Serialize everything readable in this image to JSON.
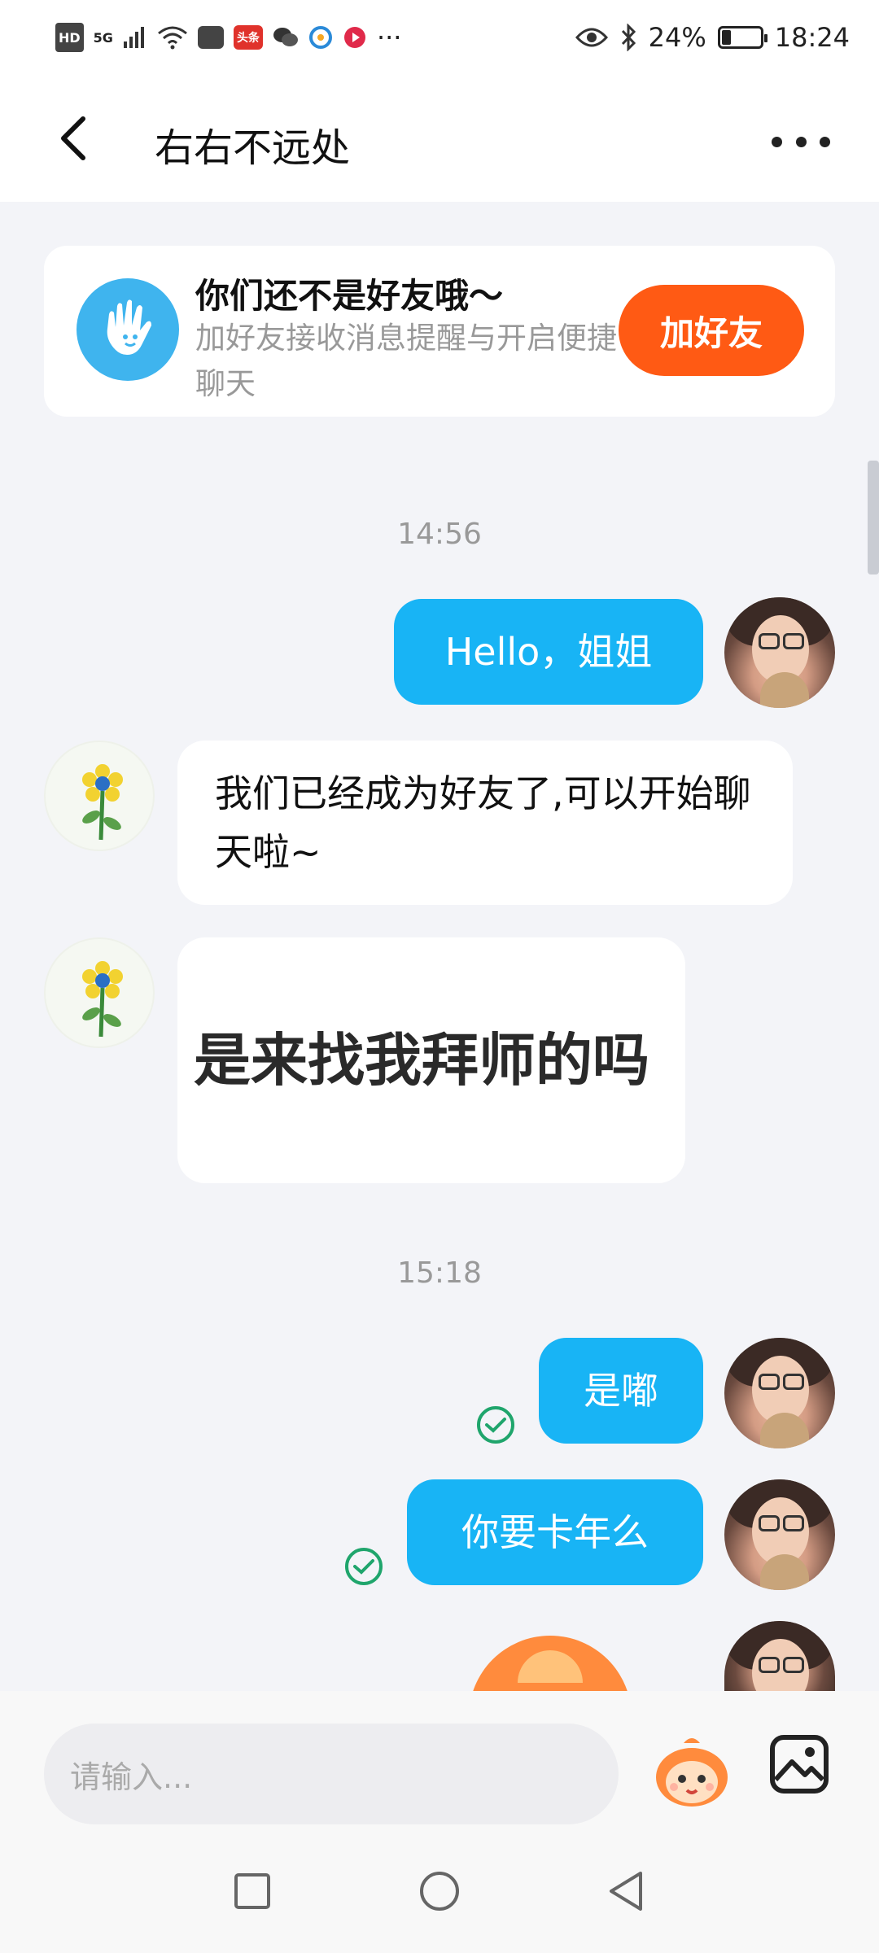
{
  "status_bar": {
    "hd": "HD",
    "network": "5G",
    "toutiao": "头条",
    "more": "···",
    "battery_text": "24%",
    "battery_level": 0.24,
    "time": "18:24"
  },
  "header": {
    "title": "右右不远处",
    "back_icon": "chevron-left",
    "more_icon": "three-dots"
  },
  "banner": {
    "title": "你们还不是好友哦～",
    "subtitle": "加好友接收消息提醒与开启便捷聊天",
    "button": "加好友",
    "icon": "hand-wave",
    "button_color": "#ff5a14"
  },
  "chat": {
    "time1": "14:56",
    "msg1": "Hello，姐姐",
    "msg2": "我们已经成为好友了,可以开始聊天啦~",
    "sticker_text": "是来找我拜师的吗",
    "time2": "15:18",
    "msg3": "是嘟",
    "msg4": "你要卡年么"
  },
  "input_bar": {
    "placeholder": "请输入...",
    "emoji_icon": "emoji-face",
    "image_icon": "image"
  },
  "colors": {
    "accent_bubble": "#18b4f5",
    "check": "#1fa56c",
    "background": "#f3f4f8"
  }
}
